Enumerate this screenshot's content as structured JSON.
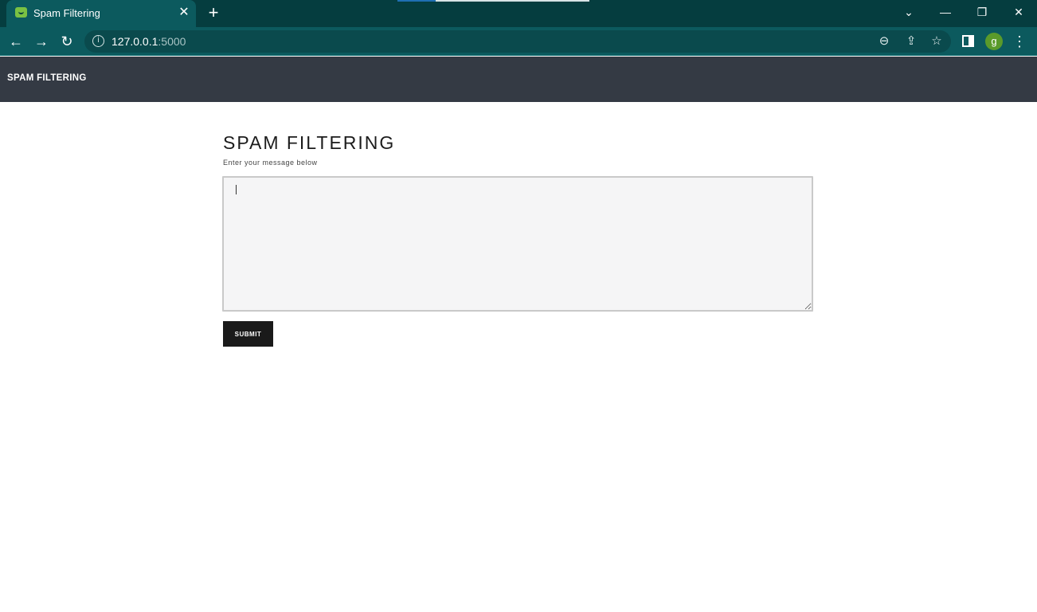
{
  "browser": {
    "tab_title": "Spam Filtering",
    "url_host": "127.0.0.1",
    "url_port": ":5000",
    "profile_initial": "g",
    "theme_color": "#053d3f"
  },
  "site": {
    "brand": "SPAM FILTERING",
    "nav_color": "#343a44"
  },
  "form": {
    "heading": "SPAM FILTERING",
    "subtext": "Enter your message below",
    "message_value": "",
    "submit_label": "SUBMIT"
  }
}
